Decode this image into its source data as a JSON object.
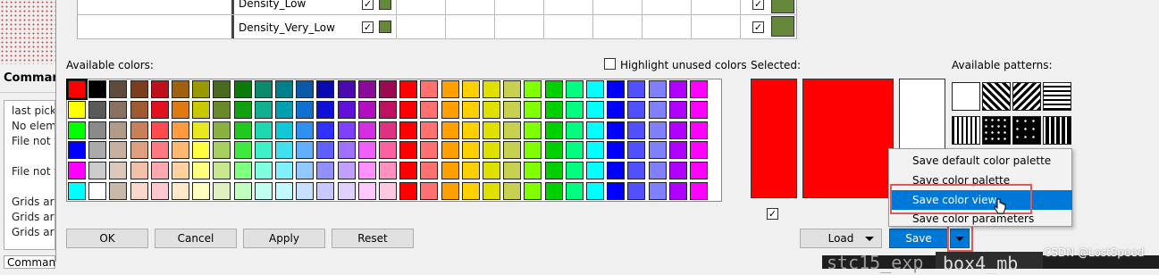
{
  "command_panel": {
    "title": "Command",
    "log_lines": [
      "last pick",
      "No elem",
      "File not f",
      "File not f",
      "Grids ar",
      "Grids ar",
      "Grids ar"
    ],
    "prompt": "Command >"
  },
  "density_grid": {
    "rows": [
      {
        "label": "Density_Low",
        "checked": true,
        "color": "#66883a",
        "checked2": true,
        "color2": "#66883a"
      },
      {
        "label": "Density_Very_Low",
        "checked": true,
        "color": "#66883a",
        "checked2": true,
        "color2": "#66883a"
      }
    ]
  },
  "available_colors": {
    "label": "Available colors:",
    "highlight_unused_label": "Highlight unused colors",
    "highlight_unused_checked": false,
    "rows": [
      [
        "#ff0000",
        "#000000",
        "#5e4b3b",
        "#7a3e1e",
        "#c0101a",
        "#a06010",
        "#9a9a00",
        "#486a1e",
        "#0a7a0a",
        "#0a8a6a",
        "#00808a",
        "#0a5aa8",
        "#0a0ab0",
        "#4a0ab0",
        "#8a0a9a",
        "#9a0a50",
        "#ff0000",
        "#ff7070",
        "#ffa000",
        "#ffd000",
        "#e0e000",
        "#c8d050",
        "#80ff00",
        "#00d000",
        "#00ff80",
        "#00ffff",
        "#0000ff",
        "#5050ff",
        "#8080ff",
        "#b000ff",
        "#ff00ff"
      ],
      [
        "#ffff00",
        "#5a5a5a",
        "#8a7060",
        "#a05a30",
        "#e01020",
        "#e07a10",
        "#c8c800",
        "#6a8a2a",
        "#10a010",
        "#10b090",
        "#00a0b0",
        "#1070d0",
        "#1010d8",
        "#6010d8",
        "#b010c0",
        "#c01060",
        "#ff0000",
        "#ff7070",
        "#ffa000",
        "#ffd000",
        "#e0e000",
        "#c8d050",
        "#80ff00",
        "#00d000",
        "#00ff80",
        "#00ffff",
        "#0000ff",
        "#5050ff",
        "#8080ff",
        "#b000ff",
        "#ff00ff"
      ],
      [
        "#00ff00",
        "#8a8a8a",
        "#b09a88",
        "#c88058",
        "#ff4a50",
        "#ff9a40",
        "#e8e820",
        "#8ab040",
        "#20c820",
        "#20d8b0",
        "#10c8d8",
        "#3090f0",
        "#3030ff",
        "#8040ff",
        "#d030e0",
        "#e03080",
        "#ff0000",
        "#ff7070",
        "#ffa000",
        "#ffd000",
        "#e0e000",
        "#c8d050",
        "#80ff00",
        "#00d000",
        "#00ff80",
        "#00ffff",
        "#0000ff",
        "#5050ff",
        "#8080ff",
        "#b000ff",
        "#ff00ff"
      ],
      [
        "#0000ff",
        "#aaaaaa",
        "#c8b0a0",
        "#e0a080",
        "#ff7a80",
        "#ffb870",
        "#ffff40",
        "#a8d060",
        "#40e840",
        "#40f0c8",
        "#40e0f0",
        "#60b0ff",
        "#6060ff",
        "#a070ff",
        "#f060f8",
        "#ff60a0",
        "#ff0000",
        "#ff7070",
        "#ffa000",
        "#ffd000",
        "#e0e000",
        "#c8d050",
        "#80ff00",
        "#00d000",
        "#00ff80",
        "#00ffff",
        "#0000ff",
        "#5050ff",
        "#8080ff",
        "#b000ff",
        "#ff00ff"
      ],
      [
        "#ff00ff",
        "#cccccc",
        "#dcc8b8",
        "#f0c0a8",
        "#ffa8b0",
        "#ffd0a0",
        "#ffff80",
        "#c8e890",
        "#80ff80",
        "#80ffe0",
        "#80f0ff",
        "#90c8ff",
        "#9090ff",
        "#c0a0ff",
        "#ff90ff",
        "#ff90c0",
        "#ff0000",
        "#ff7070",
        "#ffa000",
        "#ffd000",
        "#e0e000",
        "#c8d050",
        "#80ff00",
        "#00d000",
        "#00ff80",
        "#00ffff",
        "#0000ff",
        "#5050ff",
        "#8080ff",
        "#b000ff",
        "#ff00ff"
      ],
      [
        "#00ffff",
        "#ffffff",
        "#c8b8a8",
        "#f8d8c8",
        "#ffc8d0",
        "#ffe8c8",
        "#ffffc0",
        "#e0f0c0",
        "#c0ffc0",
        "#c0fff0",
        "#c0f8ff",
        "#c8e0ff",
        "#c8c8ff",
        "#e0d0ff",
        "#ffc8ff",
        "#ffc8e0",
        "#ff0000",
        "#ff7070",
        "#ffa000",
        "#ffd000",
        "#e0e000",
        "#c8d050",
        "#80ff00",
        "#00d000",
        "#00ff80",
        "#00ffff",
        "#0000ff",
        "#5050ff",
        "#8080ff",
        "#b000ff",
        "#ff00ff"
      ]
    ]
  },
  "selected": {
    "label": "Selected:",
    "colors": [
      "#ff0000",
      "#ff0000",
      "#ffffff"
    ],
    "checkbox_checked": true
  },
  "available_patterns": {
    "label": "Available patterns:",
    "patterns": [
      "solid-white-icon",
      "diagonal-hatch-icon",
      "back-diagonal-hatch-icon",
      "horizontal-lines-icon",
      "vertical-lines-icon",
      "triangles-pattern-icon",
      "plus-pattern-icon",
      "dash-pattern-icon"
    ]
  },
  "buttons": {
    "ok": "OK",
    "cancel": "Cancel",
    "apply": "Apply",
    "reset": "Reset",
    "load": "Load",
    "save": "Save"
  },
  "save_menu": {
    "items": [
      "Save default color palette",
      "Save color palette",
      "Save color view",
      "Save color parameters"
    ],
    "hovered_index": 2
  },
  "background_window": {
    "text1": "stc15_exp",
    "text2": "box4_mb"
  },
  "watermark": "CSDN @LostSpeed"
}
